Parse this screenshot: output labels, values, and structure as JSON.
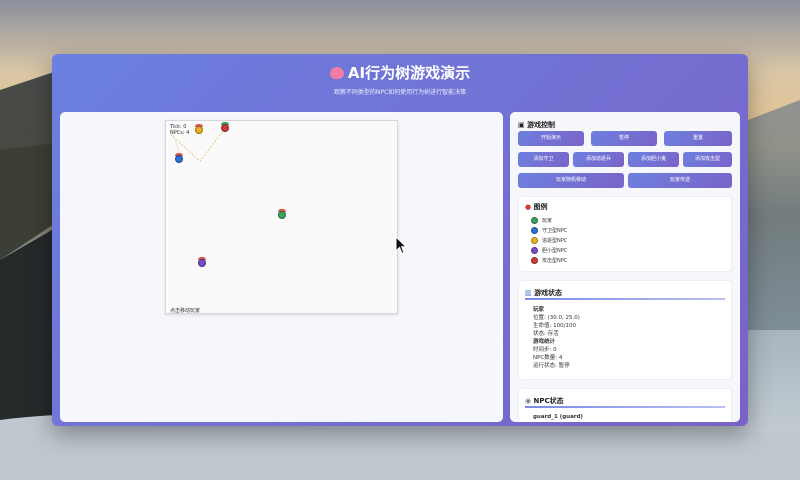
{
  "header": {
    "title": "AI行为树游戏演示",
    "subtitle": "观察不同类型的NPC如何使用行为树进行智能决策"
  },
  "canvas": {
    "tick_text": "Tick: 0",
    "npcs_text": "NPCs: 4",
    "footer_text": "点击移动玩家"
  },
  "controls": {
    "section_title": "游戏控制",
    "start_label": "开始演示",
    "pause_label": "暂停",
    "reset_label": "重置",
    "add_guard_label": "添加守卫",
    "add_hunter_label": "添加追逐兵",
    "add_coward_label": "添加胆小鬼",
    "add_attacker_label": "添加攻击型",
    "random_move_label": "玩家随机移动",
    "player_teleport_label": "玩家传送"
  },
  "legend": {
    "section_title": "图例",
    "items": [
      {
        "label": "玩家",
        "color": "#3aa35a"
      },
      {
        "label": "守卫型NPC",
        "color": "#2f6fd6"
      },
      {
        "label": "追逐型NPC",
        "color": "#e7b21f"
      },
      {
        "label": "胆小型NPC",
        "color": "#7a4cc7"
      },
      {
        "label": "攻击型NPC",
        "color": "#cc3b3b"
      }
    ]
  },
  "game_status": {
    "section_title": "游戏状态",
    "player_heading": "玩家",
    "position": "位置: (30.0, 25.0)",
    "health": "生命值: 100/100",
    "state": "状态: 存活",
    "stats_heading": "游戏统计",
    "ticks": "时间步: 0",
    "npc_count": "NPC数量: 4",
    "run_state": "运行状态: 暂停"
  },
  "npc_status": {
    "section_title": "NPC状态",
    "first_entry": "guard_1 (guard)"
  }
}
